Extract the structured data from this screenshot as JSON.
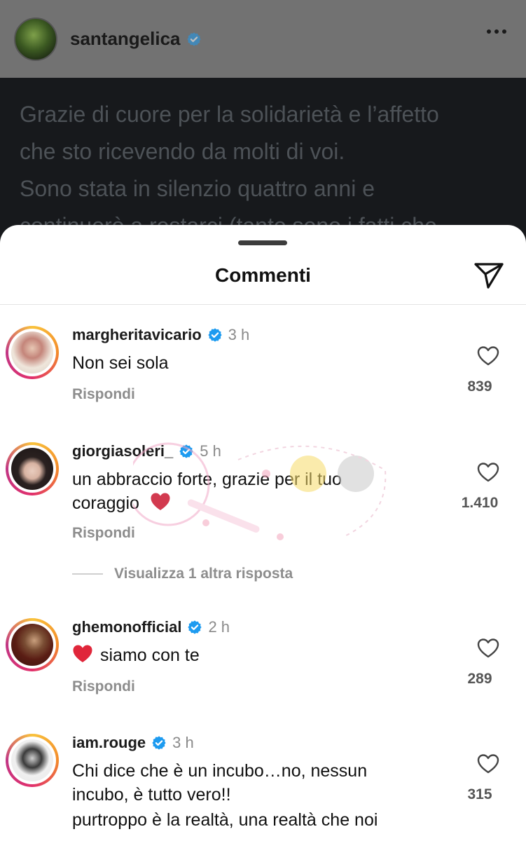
{
  "post": {
    "username": "santangelica",
    "caption_lines": [
      "Grazie di cuore per la solidarietà e l’affetto",
      "che sto ricevendo da molti di voi.",
      "Sono stata in silenzio quattro anni e",
      "continuerò a restarci (tanto sono i fatti che"
    ]
  },
  "sheet": {
    "title": "Commenti",
    "view_more": "Visualizza 1 altra risposta"
  },
  "comments": [
    {
      "username": "margheritavicario",
      "time": "3 h",
      "text": "Non sei sola",
      "reply": "Rispondi",
      "likes": "839"
    },
    {
      "username": "giorgiasoleri_",
      "time": "5 h",
      "text": "un abbraccio forte, grazie per il tuo coraggio",
      "reply": "Rispondi",
      "likes": "1.410"
    },
    {
      "username": "ghemonofficial",
      "time": "2 h",
      "text": "siamo con te",
      "reply": "Rispondi",
      "likes": "289"
    },
    {
      "username": "iam.rouge",
      "time": "3 h",
      "text": "Chi dice che è un incubo…no, nessun incubo, è tutto vero!!",
      "text2": "purtroppo è la realtà, una realtà che noi",
      "likes": "315"
    }
  ],
  "colors": {
    "verified": "#1d9bf0",
    "story_ring": "#e1306c",
    "emoji_heart": "#e0263a"
  }
}
